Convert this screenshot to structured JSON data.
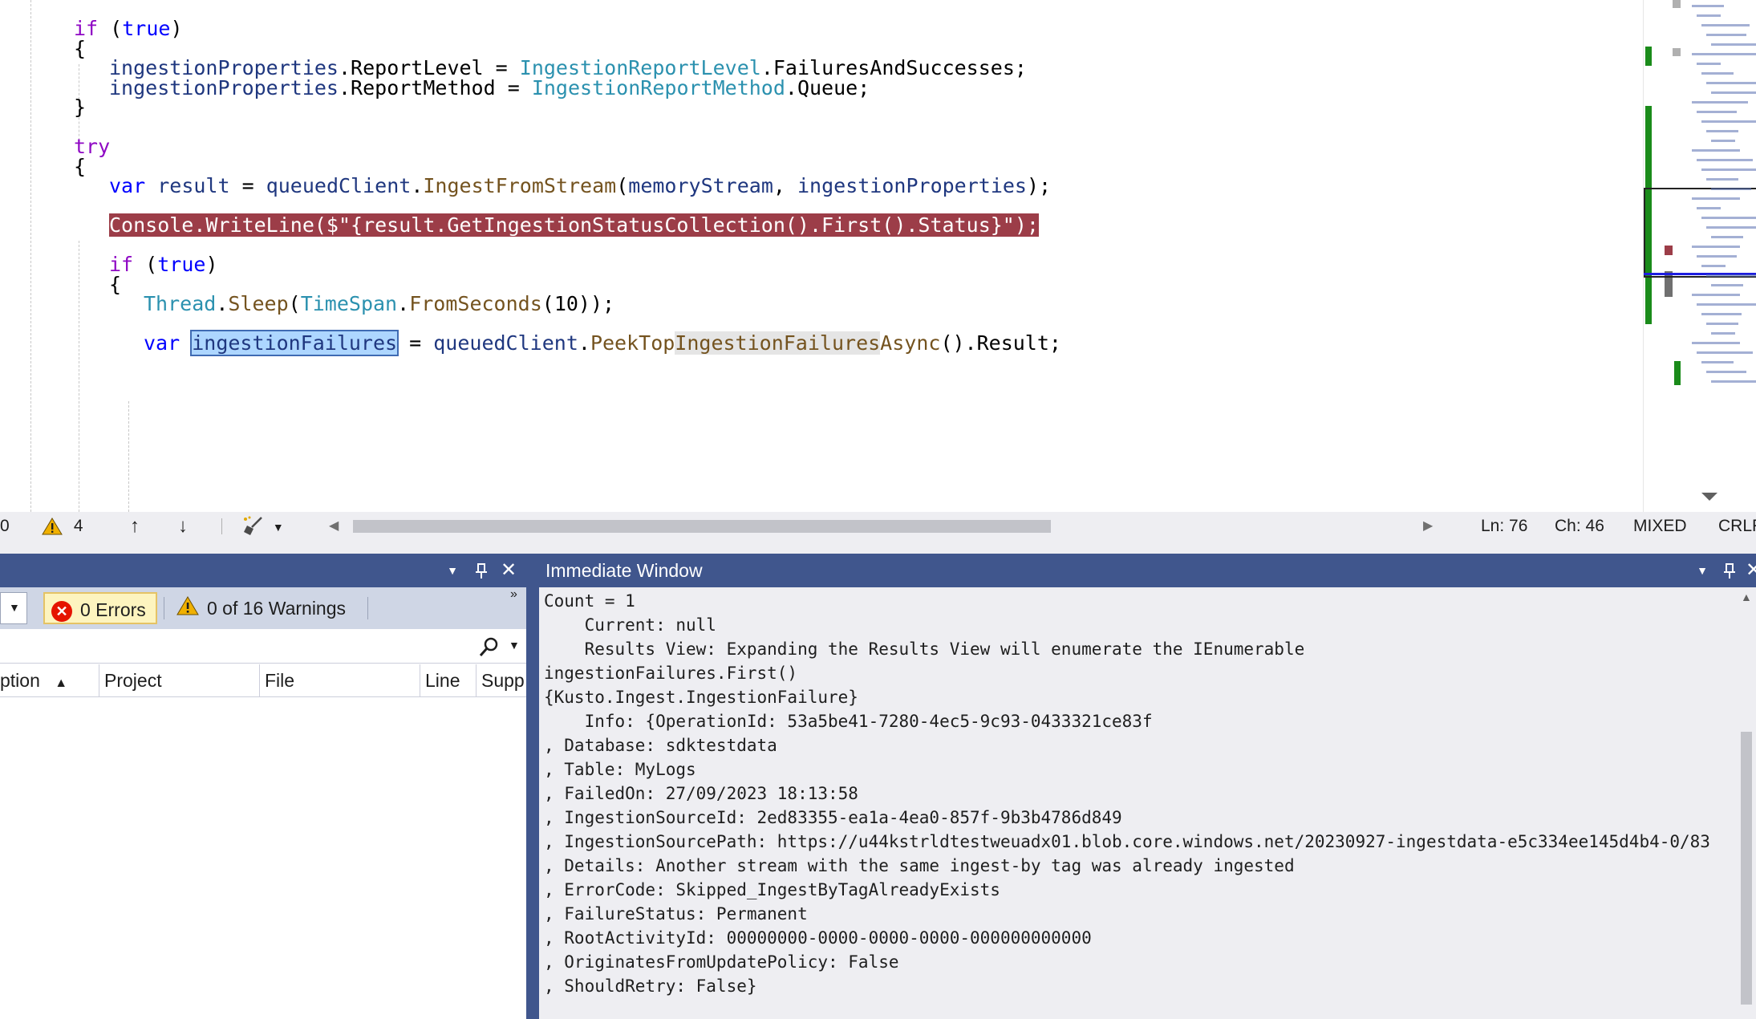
{
  "editor": {
    "lines": [
      {
        "indent": 0,
        "tokens": [
          {
            "c": "kw",
            "t": "if"
          },
          {
            "t": " ("
          },
          {
            "c": "kw2",
            "t": "true"
          },
          {
            "t": ")"
          }
        ]
      },
      {
        "indent": 0,
        "tokens": [
          {
            "t": "{"
          }
        ]
      },
      {
        "indent": 1,
        "tokens": [
          {
            "c": "id",
            "t": "ingestionProperties"
          },
          {
            "t": "."
          },
          {
            "t": "ReportLevel"
          },
          {
            "t": " = "
          },
          {
            "c": "ty",
            "t": "IngestionReportLevel"
          },
          {
            "t": ".FailuresAndSuccesses;"
          }
        ]
      },
      {
        "indent": 1,
        "tokens": [
          {
            "c": "id",
            "t": "ingestionProperties"
          },
          {
            "t": "."
          },
          {
            "t": "ReportMethod"
          },
          {
            "t": " = "
          },
          {
            "c": "ty",
            "t": "IngestionReportMethod"
          },
          {
            "t": ".Queue;"
          }
        ]
      },
      {
        "indent": 0,
        "tokens": [
          {
            "t": "}"
          }
        ]
      },
      {
        "indent": 0,
        "tokens": []
      },
      {
        "indent": 0,
        "tokens": [
          {
            "c": "kw",
            "t": "try"
          }
        ]
      },
      {
        "indent": 0,
        "tokens": [
          {
            "t": "{"
          }
        ]
      },
      {
        "indent": 1,
        "tokens": [
          {
            "c": "kw2",
            "t": "var"
          },
          {
            "t": " "
          },
          {
            "c": "id",
            "t": "result"
          },
          {
            "t": " = "
          },
          {
            "c": "id",
            "t": "queuedClient"
          },
          {
            "t": "."
          },
          {
            "c": "fn",
            "t": "IngestFromStream"
          },
          {
            "t": "("
          },
          {
            "c": "id",
            "t": "memoryStream"
          },
          {
            "t": ", "
          },
          {
            "c": "id",
            "t": "ingestionProperties"
          },
          {
            "t": ");"
          }
        ]
      },
      {
        "indent": 1,
        "tokens": []
      },
      {
        "indent": 1,
        "breakpoint": true,
        "tokens": [
          {
            "t": "Console.WriteLine($\"{result.GetIngestionStatusCollection().First().Status}\");"
          }
        ]
      },
      {
        "indent": 1,
        "tokens": []
      },
      {
        "indent": 1,
        "tokens": [
          {
            "c": "kw",
            "t": "if"
          },
          {
            "t": " ("
          },
          {
            "c": "kw2",
            "t": "true"
          },
          {
            "t": ")"
          }
        ]
      },
      {
        "indent": 1,
        "tokens": [
          {
            "t": "{"
          }
        ]
      },
      {
        "indent": 2,
        "tokens": [
          {
            "c": "ty",
            "t": "Thread"
          },
          {
            "t": "."
          },
          {
            "c": "fn",
            "t": "Sleep"
          },
          {
            "t": "("
          },
          {
            "c": "ty",
            "t": "TimeSpan"
          },
          {
            "t": "."
          },
          {
            "c": "fn",
            "t": "FromSeconds"
          },
          {
            "t": "(10));"
          }
        ]
      },
      {
        "indent": 2,
        "tokens": []
      },
      {
        "indent": 2,
        "tokens": [
          {
            "c": "kw2",
            "t": "var"
          },
          {
            "t": " "
          },
          {
            "c": "id sel-word",
            "t": "ingestionFailures"
          },
          {
            "t": " = "
          },
          {
            "c": "id",
            "t": "queuedClient"
          },
          {
            "t": "."
          },
          {
            "c": "fn",
            "t": "PeekTop"
          },
          {
            "c": "fn hl-word",
            "t": "IngestionFailures"
          },
          {
            "c": "fn",
            "t": "Async"
          },
          {
            "t": "().Result;"
          }
        ]
      }
    ]
  },
  "status": {
    "left_count": "0",
    "warnings_count": "4",
    "ln": "Ln: 76",
    "ch": "Ch: 46",
    "mixed": "MIXED",
    "crlf": "CRLF"
  },
  "error_list": {
    "errors_label": "0 Errors",
    "warnings_label": "0 of 16 Warnings",
    "columns": [
      "ption",
      "Project",
      "File",
      "Line",
      "Supp"
    ],
    "sort_indicator": "▲"
  },
  "immediate": {
    "title": "Immediate Window",
    "output": [
      "Count = 1",
      "    Current: null",
      "    Results View: Expanding the Results View will enumerate the IEnumerable",
      "ingestionFailures.First()",
      "{Kusto.Ingest.IngestionFailure}",
      "    Info: {OperationId: 53a5be41-7280-4ec5-9c93-0433321ce83f",
      ", Database: sdktestdata",
      ", Table: MyLogs",
      ", FailedOn: 27/09/2023 18:13:58",
      ", IngestionSourceId: 2ed83355-ea1a-4ea0-857f-9b3b4786d849",
      ", IngestionSourcePath: https://u44kstrldtestweuadx01.blob.core.windows.net/20230927-ingestdata-e5c334ee145d4b4-0/83",
      ", Details: Another stream with the same ingest-by tag was already ingested",
      ", ErrorCode: Skipped_IngestByTagAlreadyExists",
      ", FailureStatus: Permanent",
      ", RootActivityId: 00000000-0000-0000-0000-000000000000",
      ", OriginatesFromUpdatePolicy: False",
      ", ShouldRetry: False}"
    ]
  },
  "colors": {
    "panel_header": "#40568d",
    "breakpoint": "#9c3d48",
    "chrome": "#eeeef2"
  }
}
